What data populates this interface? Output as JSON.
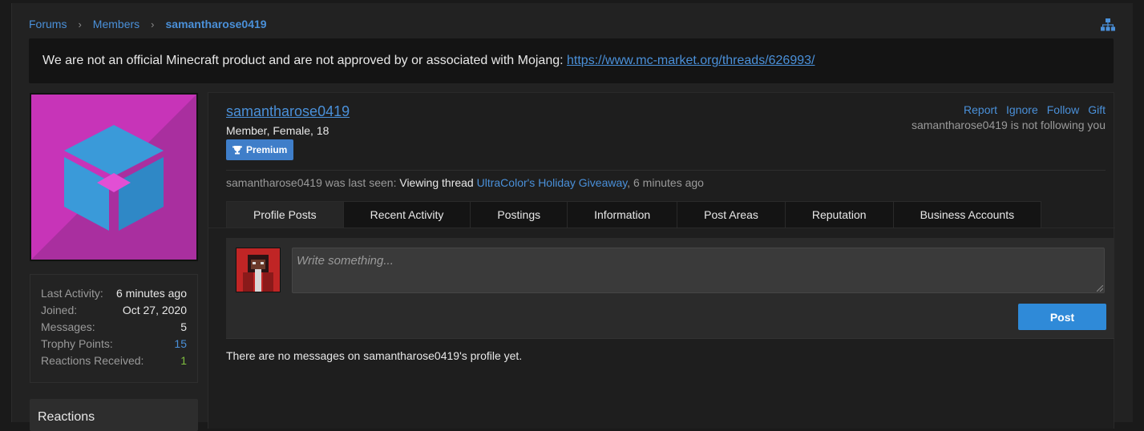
{
  "breadcrumb": {
    "items": [
      "Forums",
      "Members"
    ],
    "current": "samantharose0419"
  },
  "notice": {
    "text": "We are not an official Minecraft product and are not approved by or associated with Mojang: ",
    "link": "https://www.mc-market.org/threads/626993/"
  },
  "sidebar": {
    "stats": [
      {
        "label": "Last Activity:",
        "value": "6 minutes ago"
      },
      {
        "label": "Joined:",
        "value": "Oct 27, 2020"
      },
      {
        "label": "Messages:",
        "value": "5"
      },
      {
        "label": "Trophy Points:",
        "value": "15"
      },
      {
        "label": "Reactions Received:",
        "value": "1"
      }
    ],
    "reactions_heading": "Reactions"
  },
  "profile": {
    "username": "samantharose0419",
    "title": "Member, Female, 18",
    "badge": "Premium",
    "actions": [
      "Report",
      "Ignore",
      "Follow",
      "Gift"
    ],
    "follow_status": "samantharose0419 is not following you",
    "last_seen_prefix": "samantharose0419 was last seen: ",
    "last_seen_activity": "Viewing thread",
    "last_seen_thread": "UltraColor's Holiday Giveaway",
    "last_seen_suffix": ", 6 minutes ago"
  },
  "tabs": [
    "Profile Posts",
    "Recent Activity",
    "Postings",
    "Information",
    "Post Areas",
    "Reputation",
    "Business Accounts"
  ],
  "composer": {
    "placeholder": "Write something...",
    "post_label": "Post"
  },
  "empty_message": "There are no messages on samantharose0419's profile yet.",
  "colors": {
    "accent": "#4a90d9",
    "button": "#2f8ad8",
    "avatar_bg": "#c734b8"
  }
}
